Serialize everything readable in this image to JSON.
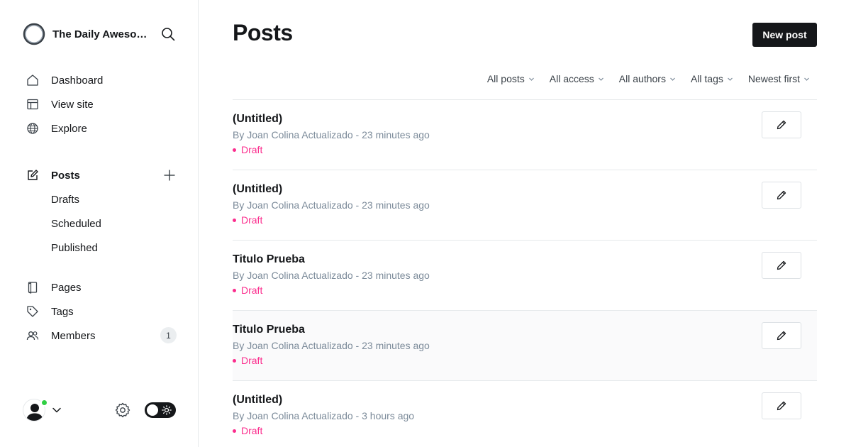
{
  "sidebar": {
    "site_name": "The Daily Awesome",
    "nav": [
      {
        "label": "Dashboard",
        "icon": "home-icon"
      },
      {
        "label": "View site",
        "icon": "layout-icon"
      },
      {
        "label": "Explore",
        "icon": "globe-icon"
      }
    ],
    "posts": {
      "label": "Posts",
      "icon": "pencil-square-icon",
      "sub": [
        "Drafts",
        "Scheduled",
        "Published"
      ]
    },
    "secondary": [
      {
        "label": "Pages",
        "icon": "page-icon"
      },
      {
        "label": "Tags",
        "icon": "tag-icon"
      },
      {
        "label": "Members",
        "icon": "members-icon",
        "count": "1"
      }
    ]
  },
  "header": {
    "title": "Posts",
    "new_post_label": "New post"
  },
  "filters": [
    "All posts",
    "All access",
    "All authors",
    "All tags",
    "Newest first"
  ],
  "posts": [
    {
      "title": "(Untitled)",
      "meta": "By Joan Colina Actualizado - 23 minutes ago",
      "status": "Draft"
    },
    {
      "title": "(Untitled)",
      "meta": "By Joan Colina Actualizado - 23 minutes ago",
      "status": "Draft"
    },
    {
      "title": "Titulo Prueba",
      "meta": "By Joan Colina Actualizado - 23 minutes ago",
      "status": "Draft"
    },
    {
      "title": "Titulo Prueba",
      "meta": "By Joan Colina Actualizado - 23 minutes ago",
      "status": "Draft"
    },
    {
      "title": "(Untitled)",
      "meta": "By Joan Colina Actualizado - 3 hours ago",
      "status": "Draft"
    }
  ],
  "colors": {
    "accent_dark": "#15171a",
    "draft": "#fb2d8d",
    "online": "#30cf43",
    "muted": "#7c8b9a"
  }
}
